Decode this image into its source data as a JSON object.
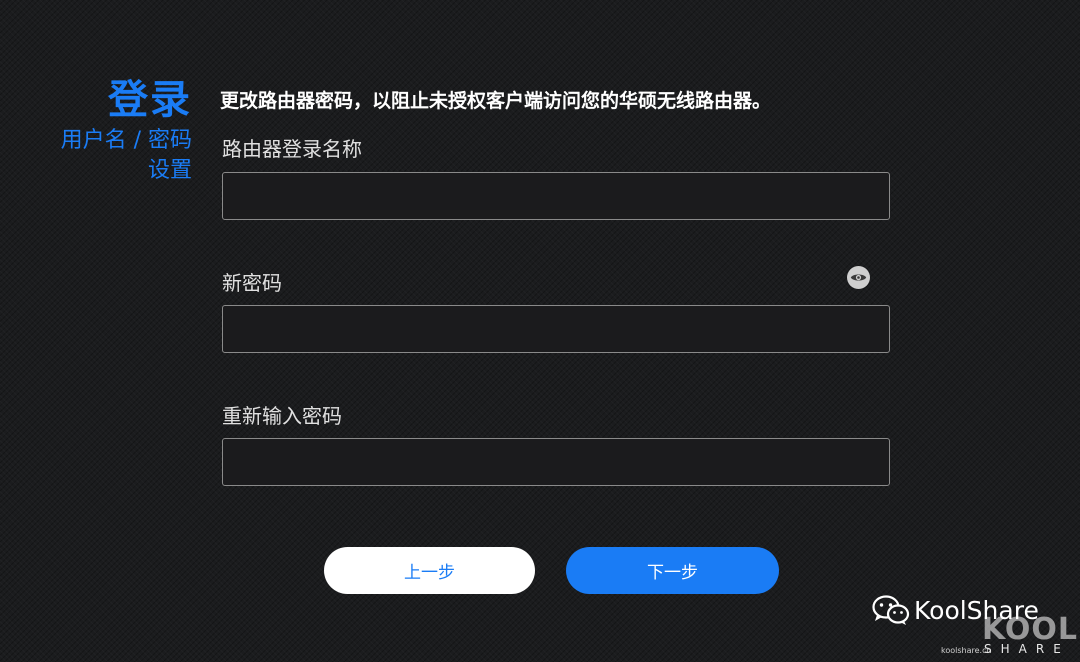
{
  "sidebar": {
    "title": "登录",
    "subtitle": "用户名 / 密码设置"
  },
  "main": {
    "description": "更改路由器密码，以阻止未授权客户端访问您的华硕无线路由器。",
    "fields": {
      "username": {
        "label": "路由器登录名称",
        "value": ""
      },
      "new_password": {
        "label": "新密码",
        "value": ""
      },
      "confirm_password": {
        "label": "重新输入密码",
        "value": ""
      }
    },
    "icons": {
      "password_toggle": "eye-icon"
    }
  },
  "buttons": {
    "prev": "上一步",
    "next": "下一步"
  },
  "watermark": {
    "brand": "KoolShare",
    "site": "koolshare.cn",
    "logo_big": "KOOL",
    "logo_small": "SHARE"
  },
  "colors": {
    "accent": "#1a7cf5",
    "background": "#1b1c1e",
    "button_prev_bg": "#ffffff"
  }
}
